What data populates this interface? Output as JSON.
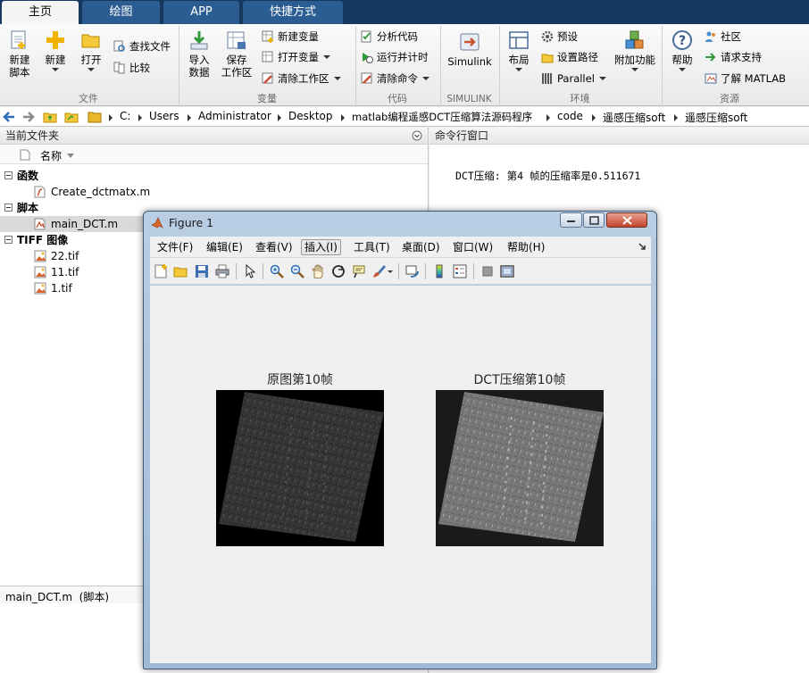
{
  "tabs": [
    {
      "label": "主页",
      "active": true
    },
    {
      "label": "绘图",
      "active": false
    },
    {
      "label": "APP",
      "active": false
    },
    {
      "label": "快捷方式",
      "active": false
    }
  ],
  "ribbon": {
    "file": {
      "group_label": "文件",
      "new_script": "新建\n脚本",
      "new": "新建",
      "open": "打开",
      "find_files": "查找文件",
      "compare": "比较"
    },
    "variable": {
      "group_label": "变量",
      "import_data": "导入\n数据",
      "save_workspace": "保存\n工作区",
      "new_variable": "新建变量",
      "open_variable": "打开变量",
      "clear_workspace": "清除工作区"
    },
    "code": {
      "group_label": "代码",
      "analyze_code": "分析代码",
      "run_and_time": "运行并计时",
      "clear_commands": "清除命令"
    },
    "simulink": {
      "group_label": "SIMULINK",
      "simulink": "Simulink"
    },
    "environment": {
      "group_label": "环境",
      "layout": "布局",
      "preferences": "预设",
      "set_path": "设置路径",
      "parallel": "Parallel",
      "addons": "附加功能"
    },
    "resources": {
      "group_label": "资源",
      "help": "帮助",
      "community": "社区",
      "request_support": "请求支持",
      "learn_matlab": "了解 MATLAB"
    }
  },
  "address": {
    "crumbs": [
      "C:",
      "Users",
      "Administrator",
      "Desktop",
      "matlab编程遥感DCT压缩算法源码程序",
      "code",
      "遥感压缩soft",
      "遥感压缩soft"
    ]
  },
  "current_folder": {
    "title": "当前文件夹",
    "name_col": "名称",
    "groups": [
      {
        "label": "函数",
        "items": [
          "Create_dctmatx.m"
        ]
      },
      {
        "label": "脚本",
        "items": [
          "main_DCT.m"
        ]
      },
      {
        "label": "TIFF 图像",
        "items": [
          "22.tif",
          "11.tif",
          "1.tif"
        ]
      }
    ],
    "selected_item": "main_DCT.m",
    "detail_label": "main_DCT.m  (脚本)"
  },
  "command_window": {
    "title": "命令行窗口",
    "output": "DCT压缩: 第4 帧的压缩率是0.511671"
  },
  "figure": {
    "title": "Figure 1",
    "menus": [
      "文件(F)",
      "编辑(E)",
      "查看(V)",
      "插入(I)",
      "工具(T)",
      "桌面(D)",
      "窗口(W)",
      "帮助(H)"
    ],
    "active_menu": "插入(I)",
    "axes": [
      {
        "title": "原图第10帧",
        "background": "#000000"
      },
      {
        "title": "DCT压缩第10帧",
        "background": "#1a1a1a"
      }
    ]
  },
  "colors": {
    "tabbar": "#16385e",
    "tab": "#2b5d93",
    "figure_frame": "#a9c1dc"
  }
}
